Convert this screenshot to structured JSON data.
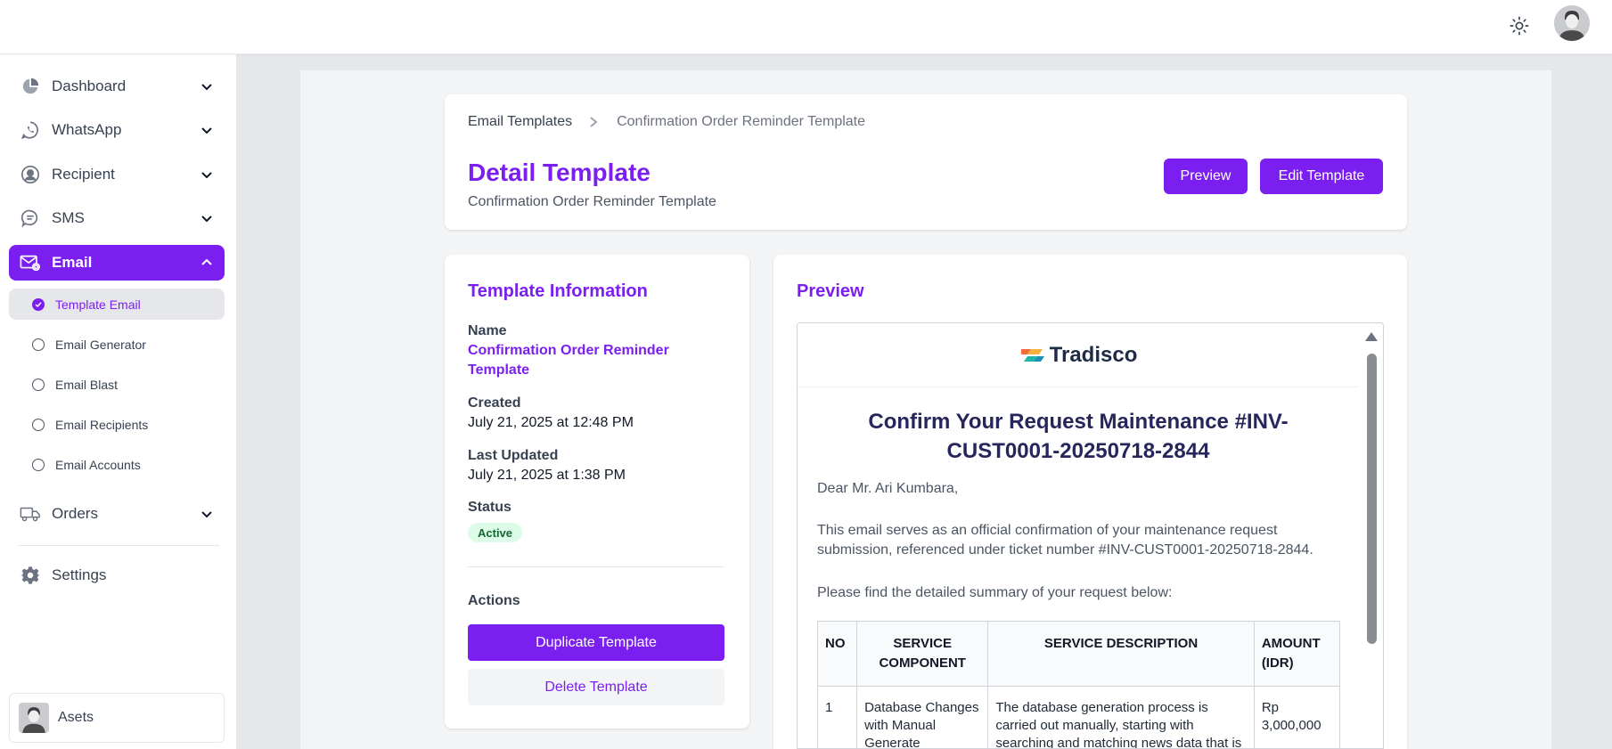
{
  "sidebar": {
    "items": [
      {
        "label": "Dashboard",
        "icon": "pie-chart-icon"
      },
      {
        "label": "WhatsApp",
        "icon": "whatsapp-icon"
      },
      {
        "label": "Recipient",
        "icon": "user-circle-icon"
      },
      {
        "label": "SMS",
        "icon": "chat-bubble-icon"
      },
      {
        "label": "Email",
        "icon": "mail-icon"
      },
      {
        "label": "Orders",
        "icon": "truck-icon"
      },
      {
        "label": "Settings",
        "icon": "gear-icon"
      }
    ],
    "email_sub": [
      {
        "label": "Template Email"
      },
      {
        "label": "Email Generator"
      },
      {
        "label": "Email Blast"
      },
      {
        "label": "Email Recipients"
      },
      {
        "label": "Email Accounts"
      }
    ],
    "user_name": "Asets"
  },
  "header": {
    "breadcrumb_root": "Email Templates",
    "breadcrumb_current": "Confirmation Order Reminder Template",
    "title": "Detail Template",
    "subtitle": "Confirmation Order Reminder Template",
    "preview_btn": "Preview",
    "edit_btn": "Edit Template"
  },
  "info": {
    "title": "Template Information",
    "name_label": "Name",
    "name_value": "Confirmation Order Reminder Template",
    "created_label": "Created",
    "created_value": "July 21, 2025 at 12:48 PM",
    "updated_label": "Last Updated",
    "updated_value": "July 21, 2025 at 1:38 PM",
    "status_label": "Status",
    "status_value": "Active",
    "actions_label": "Actions",
    "duplicate_btn": "Duplicate Template",
    "delete_btn": "Delete Template"
  },
  "preview": {
    "title": "Preview",
    "logo_text": "Tradisco",
    "email_title": "Confirm Your Request Maintenance #INV-CUST0001-20250718-2844",
    "greeting": "Dear Mr. Ari Kumbara,",
    "para1": "This email serves as an official confirmation of your maintenance request submission, referenced under ticket number #INV-CUST0001-20250718-2844.",
    "para2": "Please find the detailed summary of your request below:",
    "table": {
      "headers": [
        "NO",
        "SERVICE COMPONENT",
        "SERVICE DESCRIPTION",
        "AMOUNT (IDR)"
      ],
      "rows": [
        [
          "1",
          "Database Changes with Manual Generate",
          "The database generation process is carried out manually, starting with searching and matching news data that is",
          "Rp 3,000,000"
        ]
      ]
    }
  },
  "colors": {
    "accent": "#7b1ff0",
    "status_bg": "#dcfce7",
    "status_text": "#166534"
  }
}
